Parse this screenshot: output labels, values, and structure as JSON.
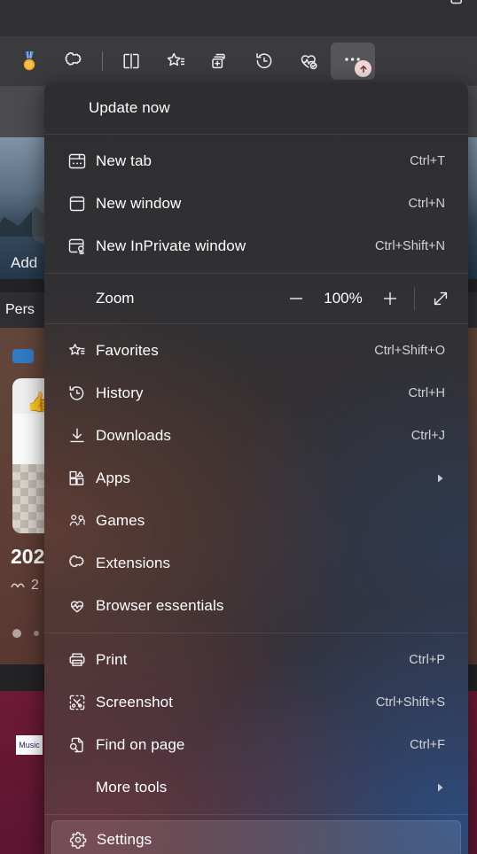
{
  "window": {
    "controls": [
      {
        "name": "minimize",
        "glyph": "minimize-icon"
      },
      {
        "name": "maximize",
        "glyph": "maximize-icon"
      }
    ]
  },
  "toolbar": {
    "buttons": [
      {
        "name": "rewards-medal",
        "icon": "medal-icon",
        "title": "Rewards"
      },
      {
        "name": "extensions",
        "icon": "extensions-puzzle-icon",
        "title": "Extensions"
      },
      {
        "name": "split-screen",
        "icon": "split-screen-icon",
        "title": "Split screen"
      },
      {
        "name": "favorites",
        "icon": "favorites-star-icon",
        "title": "Favorites"
      },
      {
        "name": "collections",
        "icon": "collections-add-icon",
        "title": "Collections"
      },
      {
        "name": "history",
        "icon": "history-clock-icon",
        "title": "History"
      },
      {
        "name": "browser-essentials",
        "icon": "heartbeat-icon",
        "title": "Browser essentials"
      },
      {
        "name": "settings-and-more",
        "icon": "ellipsis-icon",
        "title": "Settings and more",
        "badge": "update-arrow-badge",
        "active": true
      }
    ]
  },
  "page_background": {
    "add_label": "Add",
    "personalize_label": "Pers",
    "feed_title": "202",
    "feed_subtitle": "2",
    "feed_thumb_caption": "Music"
  },
  "menu": {
    "update": {
      "label": "Update now"
    },
    "zoom": {
      "label": "Zoom",
      "value": "100%",
      "minus_icon": "minus-icon",
      "plus_icon": "plus-icon",
      "fullscreen_icon": "fullscreen-diagonal-icon"
    },
    "group1": [
      {
        "label": "New tab",
        "accel": "Ctrl+T",
        "icon": "new-tab-icon",
        "submenu": false
      },
      {
        "label": "New window",
        "accel": "Ctrl+N",
        "icon": "new-window-icon",
        "submenu": false
      },
      {
        "label": "New InPrivate window",
        "accel": "Ctrl+Shift+N",
        "icon": "inprivate-icon",
        "submenu": false
      }
    ],
    "group2": [
      {
        "label": "Favorites",
        "accel": "Ctrl+Shift+O",
        "icon": "favorites-star-icon",
        "submenu": false
      },
      {
        "label": "History",
        "accel": "Ctrl+H",
        "icon": "history-clock-icon",
        "submenu": false
      },
      {
        "label": "Downloads",
        "accel": "Ctrl+J",
        "icon": "downloads-icon",
        "submenu": false
      },
      {
        "label": "Apps",
        "accel": "",
        "icon": "apps-grid-icon",
        "submenu": true
      },
      {
        "label": "Games",
        "accel": "",
        "icon": "games-icon",
        "submenu": false
      },
      {
        "label": "Extensions",
        "accel": "",
        "icon": "extensions-puzzle-icon",
        "submenu": false
      },
      {
        "label": "Browser essentials",
        "accel": "",
        "icon": "heartbeat-icon",
        "submenu": false
      }
    ],
    "group3": [
      {
        "label": "Print",
        "accel": "Ctrl+P",
        "icon": "printer-icon",
        "submenu": false
      },
      {
        "label": "Screenshot",
        "accel": "Ctrl+Shift+S",
        "icon": "screenshot-icon",
        "submenu": false
      },
      {
        "label": "Find on page",
        "accel": "Ctrl+F",
        "icon": "find-page-icon",
        "submenu": false
      },
      {
        "label": "More tools",
        "accel": "",
        "icon": "",
        "submenu": true
      }
    ],
    "group4": [
      {
        "label": "Settings",
        "accel": "",
        "icon": "gear-icon",
        "submenu": false,
        "selected": true
      }
    ]
  },
  "colors": {
    "toolbar_bg": "#3b3b3e",
    "titlebar_bg": "#313134",
    "menu_text": "#ffffff",
    "accel_text": "#d3d3d6",
    "selected_row": "rgba(255,255,255,0.115)",
    "update_badge": "#f3d8d6"
  }
}
